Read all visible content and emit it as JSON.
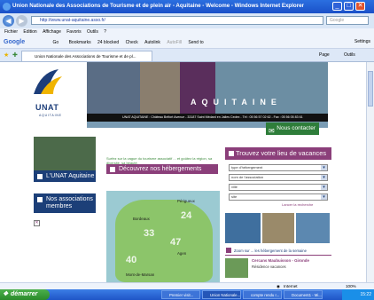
{
  "window": {
    "title": "Union Nationale des Associations de Tourisme et de plein air - Aquitaine - Welcome - Windows Internet Explorer"
  },
  "address": {
    "url": "http://www.unat-aquitaine.asso.fr/",
    "search_placeholder": "Google"
  },
  "menu": {
    "items": [
      "Fichier",
      "Edition",
      "Affichage",
      "Favoris",
      "Outils",
      "?"
    ]
  },
  "gtoolbar": {
    "logo": "Google",
    "items": [
      "Go",
      "Bookmarks",
      "24 blocked",
      "Check",
      "Autolink",
      "AutoFill",
      "Send to"
    ],
    "settings": "Settings"
  },
  "tab": {
    "label": "Union Nationale des Associations de Tourisme et de pl...",
    "page": "Page",
    "tools": "Outils"
  },
  "banner": {
    "org": "UNAT",
    "org_sub": "AQUITAINE",
    "region": "AQUITAINE",
    "address_line": "UNAT AQUITAINE : Château Belfort Avenue - 33187 Saint Médard en Jalles Cedex - Tél : 05 56 57 02 62 - Fax : 05 56 05 83 61",
    "contact": "Nous contacter"
  },
  "left": {
    "unat_label": "L'UNAT Aquitaine",
    "members_label": "Nos associations membres"
  },
  "center": {
    "tagline": "Surfez sur la vague du tourisme associatif ... et goûtez la région, sa diversité, sa beauté.",
    "discover": "Découvrez nos hébergements"
  },
  "map": {
    "cities": [
      "Bordeaux",
      "Périgueux",
      "Agen",
      "Mont-de-Marsan"
    ],
    "zones": [
      "33",
      "24",
      "40",
      "47"
    ]
  },
  "search": {
    "title": "Trouvez votre lieu de vacances",
    "selects": [
      "type d'hébergement",
      "nom de l'association",
      "ville",
      "site"
    ],
    "reset": "Lancer la recherche"
  },
  "news": {
    "zoom_title": "Zoom sur ... les hébergement de la semaine",
    "item_title": "Cercans Maubuisson - Gironde",
    "item_sub": "Résidence vacances"
  },
  "statusbar": {
    "zone": "Internet",
    "zoom": "100%"
  },
  "taskbar": {
    "start": "démarrer",
    "tasks": [
      "Premier visit...",
      "Union Nationale...",
      "compte rendu r...",
      "Document1 - Mi..."
    ],
    "clock": "15:22"
  }
}
